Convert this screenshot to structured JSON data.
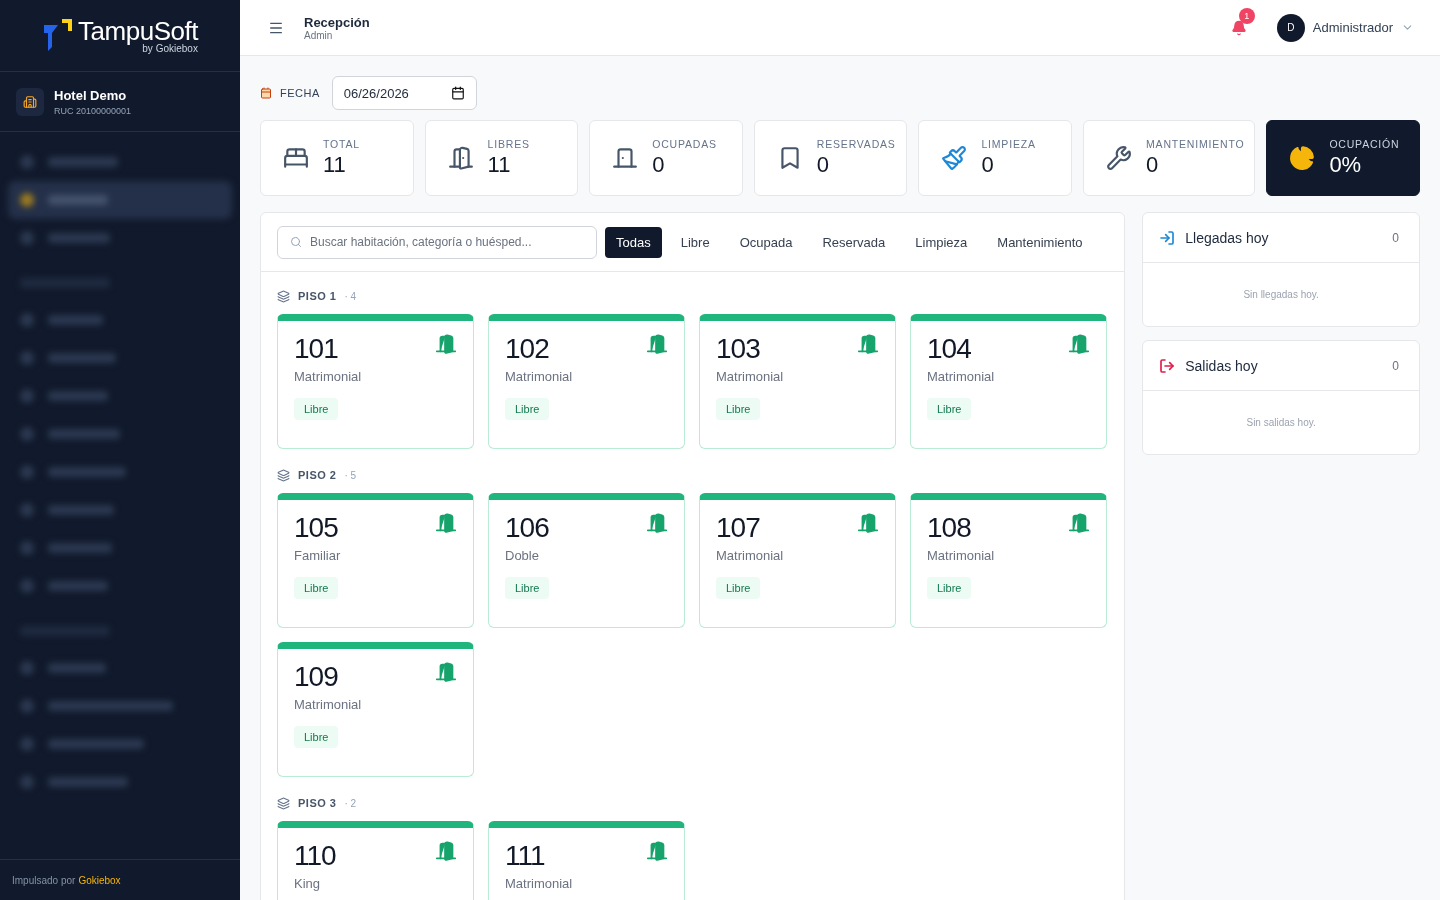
{
  "sidebar": {
    "logo": {
      "name": "TampuSoft",
      "byline": "by Gokiebox"
    },
    "hotel": {
      "name": "Hotel Demo",
      "ruc": "RUC 20100000001"
    },
    "blurred_items": [
      {
        "kind": "item",
        "selected": false
      },
      {
        "kind": "item",
        "selected": true
      },
      {
        "kind": "item",
        "selected": false
      },
      {
        "kind": "heading"
      },
      {
        "kind": "item",
        "selected": false
      },
      {
        "kind": "item",
        "selected": false
      },
      {
        "kind": "item",
        "selected": false
      },
      {
        "kind": "item",
        "selected": false
      },
      {
        "kind": "item",
        "selected": false
      },
      {
        "kind": "item",
        "selected": false
      },
      {
        "kind": "item",
        "selected": false
      },
      {
        "kind": "item",
        "selected": false
      },
      {
        "kind": "heading"
      },
      {
        "kind": "item",
        "selected": false
      },
      {
        "kind": "item",
        "selected": false
      },
      {
        "kind": "item",
        "selected": false
      },
      {
        "kind": "item",
        "selected": false
      }
    ],
    "footer": {
      "prefix": "Impulsado por",
      "brand": "Gokiebox"
    }
  },
  "header": {
    "title": "Recepción",
    "subtitle": "Admin",
    "notifications": "1",
    "user_initial": "D",
    "user_name": "Administrador"
  },
  "date_filter": {
    "label": "FECHA",
    "value": "06/26/2026"
  },
  "stats": [
    {
      "label": "TOTAL",
      "value": "11",
      "kind": "plain"
    },
    {
      "label": "LIBRES",
      "value": "11",
      "kind": "plain"
    },
    {
      "label": "OCUPADAS",
      "value": "0",
      "kind": "plain"
    },
    {
      "label": "RESERVADAS",
      "value": "0",
      "kind": "plain"
    },
    {
      "label": "LIMPIEZA",
      "value": "0",
      "kind": "plain"
    },
    {
      "label": "MANTENIMIENTO",
      "value": "0",
      "kind": "plain"
    },
    {
      "label": "OCUPACIÓN",
      "value": "0%",
      "kind": "dark"
    }
  ],
  "search": {
    "placeholder": "Buscar habitación, categoría o huésped..."
  },
  "filters": [
    {
      "label": "Todas",
      "selected": true
    },
    {
      "label": "Libre",
      "selected": false
    },
    {
      "label": "Ocupada",
      "selected": false
    },
    {
      "label": "Reservada",
      "selected": false
    },
    {
      "label": "Limpieza",
      "selected": false
    },
    {
      "label": "Mantenimiento",
      "selected": false
    }
  ],
  "floors": [
    {
      "name": "PISO 1",
      "count": "· 4",
      "rooms": [
        {
          "number": "101",
          "category": "Matrimonial",
          "status": "Libre",
          "kind": "free"
        },
        {
          "number": "102",
          "category": "Matrimonial",
          "status": "Libre",
          "kind": "free"
        },
        {
          "number": "103",
          "category": "Matrimonial",
          "status": "Libre",
          "kind": "free"
        },
        {
          "number": "104",
          "category": "Matrimonial",
          "status": "Libre",
          "kind": "free"
        }
      ]
    },
    {
      "name": "PISO 2",
      "count": "· 5",
      "rooms": [
        {
          "number": "105",
          "category": "Familiar",
          "status": "Libre",
          "kind": "free"
        },
        {
          "number": "106",
          "category": "Doble",
          "status": "Libre",
          "kind": "free"
        },
        {
          "number": "107",
          "category": "Matrimonial",
          "status": "Libre",
          "kind": "free"
        },
        {
          "number": "108",
          "category": "Matrimonial",
          "status": "Libre",
          "kind": "free"
        },
        {
          "number": "109",
          "category": "Matrimonial",
          "status": "Libre",
          "kind": "free"
        }
      ]
    },
    {
      "name": "PISO 3",
      "count": "· 2",
      "rooms": [
        {
          "number": "110",
          "category": "King",
          "kind": "free"
        },
        {
          "number": "111",
          "category": "Matrimonial",
          "kind": "free"
        }
      ]
    }
  ],
  "side_panels": [
    {
      "title": "Llegadas hoy",
      "count": "0",
      "empty": "Sin llegadas hoy.",
      "kind": "arrivals"
    },
    {
      "title": "Salidas hoy",
      "count": "0",
      "empty": "Sin salidas hoy.",
      "kind": "departures"
    }
  ]
}
